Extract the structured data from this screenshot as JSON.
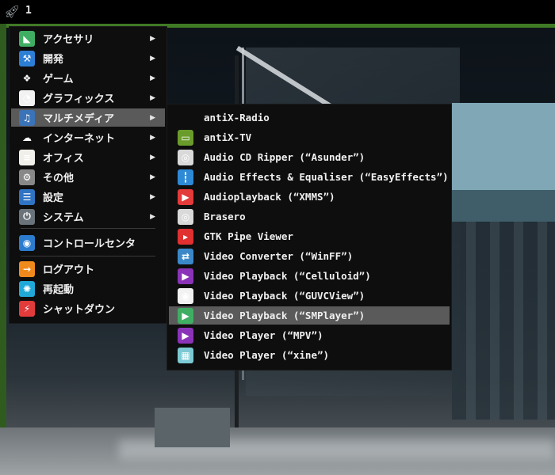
{
  "taskbar": {
    "workspace": "1",
    "start_icon": "rocket-icon"
  },
  "main_menu": {
    "items": [
      {
        "label": "アクセサリ",
        "icon": "accessories-icon",
        "submenu": true
      },
      {
        "label": "開発",
        "icon": "development-icon",
        "submenu": true
      },
      {
        "label": "ゲーム",
        "icon": "gamepad-icon",
        "submenu": true
      },
      {
        "label": "グラフィックス",
        "icon": "graphics-icon",
        "submenu": true
      },
      {
        "label": "マルチメディア",
        "icon": "multimedia-icon",
        "submenu": true,
        "active": true
      },
      {
        "label": "インターネット",
        "icon": "cloud-icon",
        "submenu": true
      },
      {
        "label": "オフィス",
        "icon": "office-icon",
        "submenu": true
      },
      {
        "label": "その他",
        "icon": "other-icon",
        "submenu": true
      },
      {
        "label": "設定",
        "icon": "settings-icon",
        "submenu": true
      },
      {
        "label": "システム",
        "icon": "system-icon",
        "submenu": true
      },
      {
        "label": "コントロールセンタ",
        "icon": "control-center-icon",
        "submenu": false
      },
      {
        "label": "ログアウト",
        "icon": "logout-icon",
        "submenu": false
      },
      {
        "label": "再起動",
        "icon": "reboot-icon",
        "submenu": false
      },
      {
        "label": "シャットダウン",
        "icon": "shutdown-icon",
        "submenu": false
      }
    ]
  },
  "sub_menu": {
    "items": [
      {
        "label": "antiX-Radio",
        "icon": "none"
      },
      {
        "label": "antiX-TV",
        "icon": "tv-icon"
      },
      {
        "label": "Audio CD Ripper (“Asunder”)",
        "icon": "cd-icon"
      },
      {
        "label": "Audio Effects & Equaliser (“EasyEffects”)",
        "icon": "equalizer-icon"
      },
      {
        "label": "Audioplayback (“XMMS”)",
        "icon": "play-icon"
      },
      {
        "label": "Brasero",
        "icon": "disc-burner-icon"
      },
      {
        "label": "GTK Pipe Viewer",
        "icon": "youtube-icon"
      },
      {
        "label": "Video Converter (“WinFF”)",
        "icon": "converter-icon"
      },
      {
        "label": "Video Playback (“Celluloid”)",
        "icon": "celluloid-icon"
      },
      {
        "label": "Video Playback (“GUVCView”)",
        "icon": "webcam-icon"
      },
      {
        "label": "Video Playback (“SMPlayer”)",
        "icon": "smplayer-icon",
        "active": true
      },
      {
        "label": "Video Player (“MPV”)",
        "icon": "mpv-icon"
      },
      {
        "label": "Video Player (“xine”)",
        "icon": "clapper-icon"
      }
    ]
  },
  "colors": {
    "menu_bg": "#0e0e0e",
    "highlight": "#5a5a5a",
    "panel_accent": "#3f7a25"
  }
}
